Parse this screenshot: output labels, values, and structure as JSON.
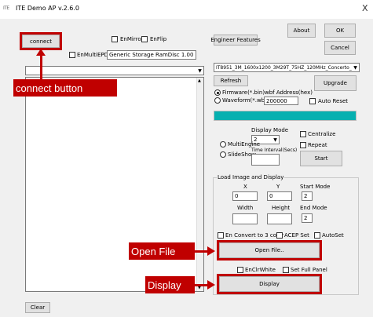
{
  "window": {
    "title": "ITE Demo AP v.2.6.0",
    "app_icon_text": "ITE",
    "close_glyph": "X"
  },
  "toolbar": {
    "connect_label": "connect",
    "en_mirror_label": "EnMirror",
    "en_flip_label": "EnFlip",
    "en_multi_epd_label": "EnMultiEPD",
    "device_name": "Generic Storage RamDisc 1.00",
    "engineer_features_label": "Engineer Features",
    "about_label": "About",
    "ok_label": "OK",
    "cancel_label": "Cancel",
    "clear_label": "Clear"
  },
  "firmware": {
    "selected_file": "IT8951_3M_1600x1200_3M29T_75HZ_120MHz_Concerto_S",
    "refresh_label": "Refresh",
    "upgrade_label": "Upgrade",
    "firmware_option_label": "Firmware(*.bin)",
    "waveform_option_label": "Waveform(*.wbf)",
    "wbf_address_label": "wbf Address(hex)",
    "wbf_address_value": "200000",
    "auto_reset_label": "Auto Reset",
    "progress_fraction": 1.0,
    "progress_color": "#06b0b0"
  },
  "display_mode": {
    "label": "Display Mode",
    "value": "2",
    "multi_engine_label": "MultiEngine",
    "slide_show_label": "SlideShow",
    "time_interval_label": "Time Interval(Secs)",
    "centralize_label": "Centralize",
    "repeat_label": "Repeat",
    "start_label": "Start"
  },
  "load_image": {
    "group_label": "Load Image and Display",
    "x_label": "X",
    "y_label": "Y",
    "start_mode_label": "Start Mode",
    "x_value": "0",
    "y_value": "0",
    "start_mode_value": "2",
    "width_label": "Width",
    "height_label": "Height",
    "end_mode_label": "End Mode",
    "width_value": "",
    "height_value": "",
    "end_mode_value": "2",
    "en_convert_label": "En Convert to 3 color",
    "acep_set_label": "ACEP Set",
    "auto_set_label": "AutoSet",
    "open_file_label": "Open File..",
    "en_clr_white_label": "EnClrWhite",
    "set_full_panel_label": "Set Full Panel",
    "display_label": "Display"
  },
  "annotations": {
    "connect_callout": "connect button",
    "open_file_callout": "Open File",
    "display_callout": "Display",
    "color": "#c00000"
  }
}
